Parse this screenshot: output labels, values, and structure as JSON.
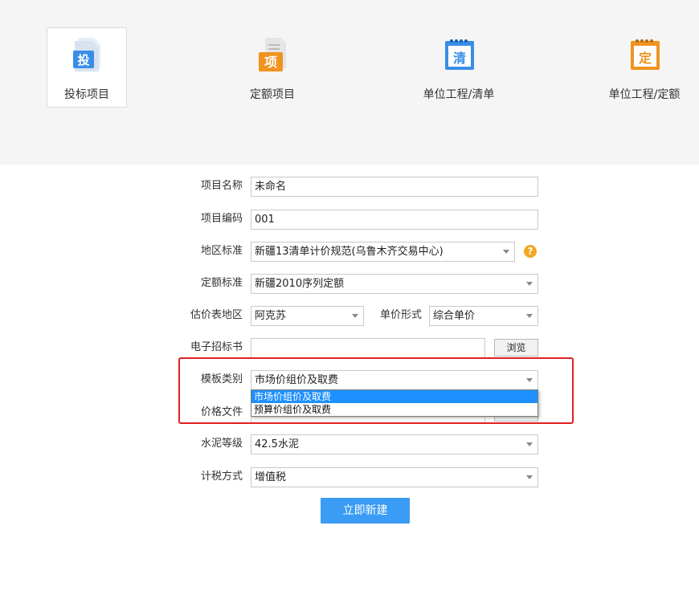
{
  "project_types": [
    {
      "label": "投标项目",
      "icon_char": "投",
      "color": "#3a8ee6",
      "icon": "bid-project-icon"
    },
    {
      "label": "定额项目",
      "icon_char": "项",
      "color": "#f0931f",
      "icon": "quota-project-icon"
    },
    {
      "label": "单位工程/清单",
      "icon_char": "清",
      "color": "#3a8ee6",
      "icon": "unit-bill-icon"
    },
    {
      "label": "单位工程/定额",
      "icon_char": "定",
      "color": "#f0931f",
      "icon": "unit-quota-icon"
    }
  ],
  "form": {
    "project_name": {
      "label": "项目名称",
      "value": "未命名"
    },
    "project_code": {
      "label": "项目编码",
      "value": "001"
    },
    "region_standard": {
      "label": "地区标准",
      "value": "新疆13清单计价规范(乌鲁木齐交易中心)",
      "help": "?"
    },
    "quota_standard": {
      "label": "定额标准",
      "value": "新疆2010序列定额"
    },
    "price_region": {
      "label": "估价表地区",
      "value": "阿克苏"
    },
    "unit_price_form": {
      "label": "单价形式",
      "value": "综合单价"
    },
    "tender_file": {
      "label": "电子招标书",
      "value": "",
      "browse": "浏览"
    },
    "template_category": {
      "label": "模板类别",
      "value": "市场价组价及取费",
      "options": [
        "市场价组价及取费",
        "预算价组价及取费"
      ]
    },
    "price_file": {
      "label": "价格文件"
    },
    "cement_grade": {
      "label": "水泥等级",
      "value": "42.5水泥"
    },
    "tax_method": {
      "label": "计税方式",
      "value": "增值税"
    },
    "submit": "立即新建"
  }
}
